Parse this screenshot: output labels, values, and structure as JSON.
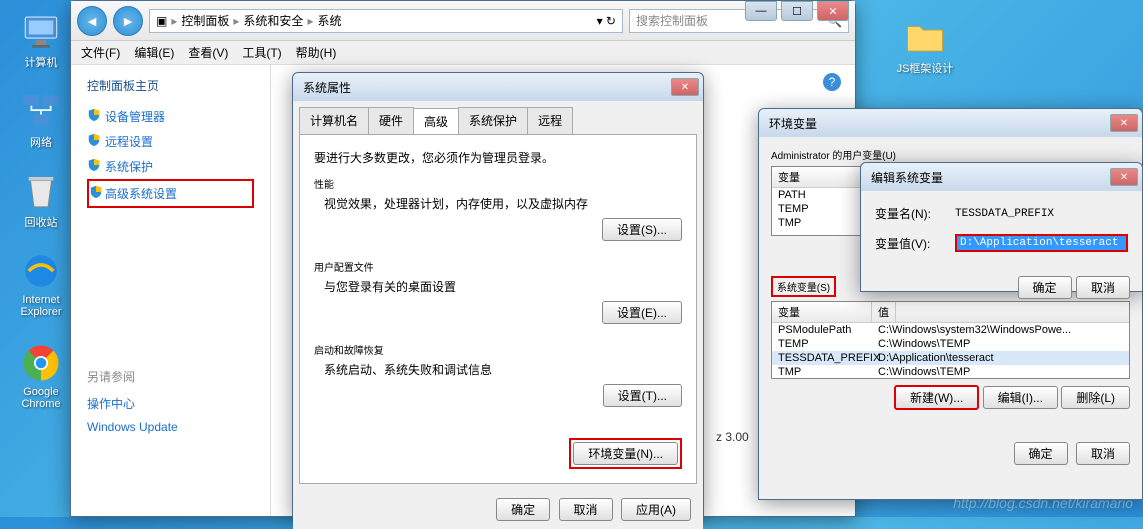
{
  "desktop": {
    "computer": "计算机",
    "network": "网络",
    "recycle": "回收站",
    "ie": "Internet Explorer",
    "chrome": "Google Chrome",
    "folder": "JS框架设计"
  },
  "explorer": {
    "breadcrumb": {
      "root": "控制面板",
      "p1": "系统和安全",
      "p2": "系统"
    },
    "search_placeholder": "搜索控制面板",
    "menu": {
      "file": "文件(F)",
      "edit": "编辑(E)",
      "view": "查看(V)",
      "tools": "工具(T)",
      "help": "帮助(H)"
    },
    "side": {
      "home": "控制面板主页",
      "devmgr": "设备管理器",
      "remote": "远程设置",
      "protect": "系统保护",
      "advanced": "高级系统设置",
      "seealso": "另请参阅",
      "action": "操作中心",
      "winup": "Windows Update"
    }
  },
  "sysprops": {
    "title": "系统属性",
    "tabs": {
      "name": "计算机名",
      "hw": "硬件",
      "adv": "高级",
      "protect": "系统保护",
      "remote": "远程"
    },
    "intro": "要进行大多数更改，您必须作为管理员登录。",
    "perf": {
      "h": "性能",
      "d": "视觉效果，处理器计划，内存使用，以及虚拟内存",
      "btn": "设置(S)..."
    },
    "prof": {
      "h": "用户配置文件",
      "d": "与您登录有关的桌面设置",
      "btn": "设置(E)..."
    },
    "start": {
      "h": "启动和故障恢复",
      "d": "系统启动、系统失败和调试信息",
      "btn": "设置(T)..."
    },
    "env_btn": "环境变量(N)...",
    "ok": "确定",
    "cancel": "取消",
    "apply": "应用(A)"
  },
  "envdlg": {
    "title": "环境变量",
    "user_h": "Administrator 的用户变量(U)",
    "sys_h": "系统变量(S)",
    "col_var": "变量",
    "col_val": "值",
    "user_rows": [
      {
        "k": "PATH",
        "v": ""
      },
      {
        "k": "TEMP",
        "v": ""
      },
      {
        "k": "TMP",
        "v": ""
      }
    ],
    "sys_rows": [
      {
        "k": "PSModulePath",
        "v": "C:\\Windows\\system32\\WindowsPowe..."
      },
      {
        "k": "TEMP",
        "v": "C:\\Windows\\TEMP"
      },
      {
        "k": "TESSDATA_PREFIX",
        "v": "D:\\Application\\tesseract"
      },
      {
        "k": "TMP",
        "v": "C:\\Windows\\TEMP"
      }
    ],
    "new": "新建(W)...",
    "edit": "编辑(I)...",
    "del": "删除(L)",
    "ok": "确定",
    "cancel": "取消"
  },
  "editdlg": {
    "title": "编辑系统变量",
    "name_l": "变量名(N):",
    "name_v": "TESSDATA_PREFIX",
    "val_l": "变量值(V):",
    "val_v": "D:\\Application\\tesseract",
    "ok": "确定",
    "cancel": "取消"
  },
  "version": "z  3.00",
  "watermark": "http://blog.csdn.net/kiramario"
}
